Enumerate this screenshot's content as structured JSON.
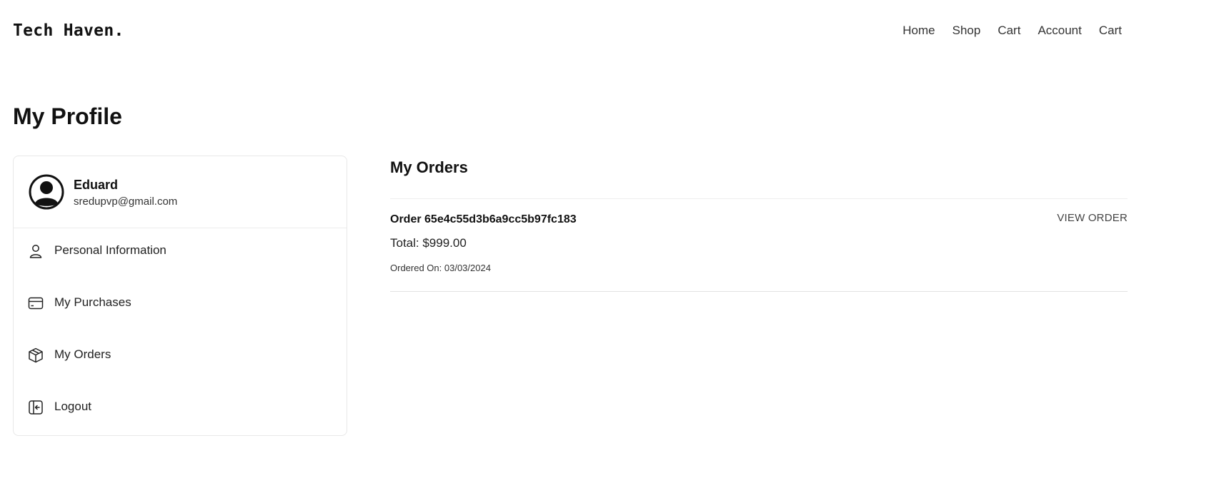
{
  "header": {
    "logo": "Tech Haven.",
    "nav": [
      "Home",
      "Shop",
      "Cart",
      "Account",
      "Cart"
    ]
  },
  "page": {
    "title": "My Profile"
  },
  "sidebar": {
    "user": {
      "name": "Eduard",
      "email": "sredupvp@gmail.com",
      "avatar_icon": "user-circle-icon"
    },
    "items": [
      {
        "label": "Personal Information",
        "icon": "user-icon"
      },
      {
        "label": "My Purchases",
        "icon": "credit-card-icon"
      },
      {
        "label": "My Orders",
        "icon": "box-icon"
      },
      {
        "label": "Logout",
        "icon": "logout-icon"
      }
    ]
  },
  "orders": {
    "title": "My Orders",
    "list": [
      {
        "id": "Order 65e4c55d3b6a9cc5b97fc183",
        "total": "Total: $999.00",
        "date": "Ordered On: 03/03/2024",
        "action": "VIEW ORDER"
      }
    ]
  }
}
